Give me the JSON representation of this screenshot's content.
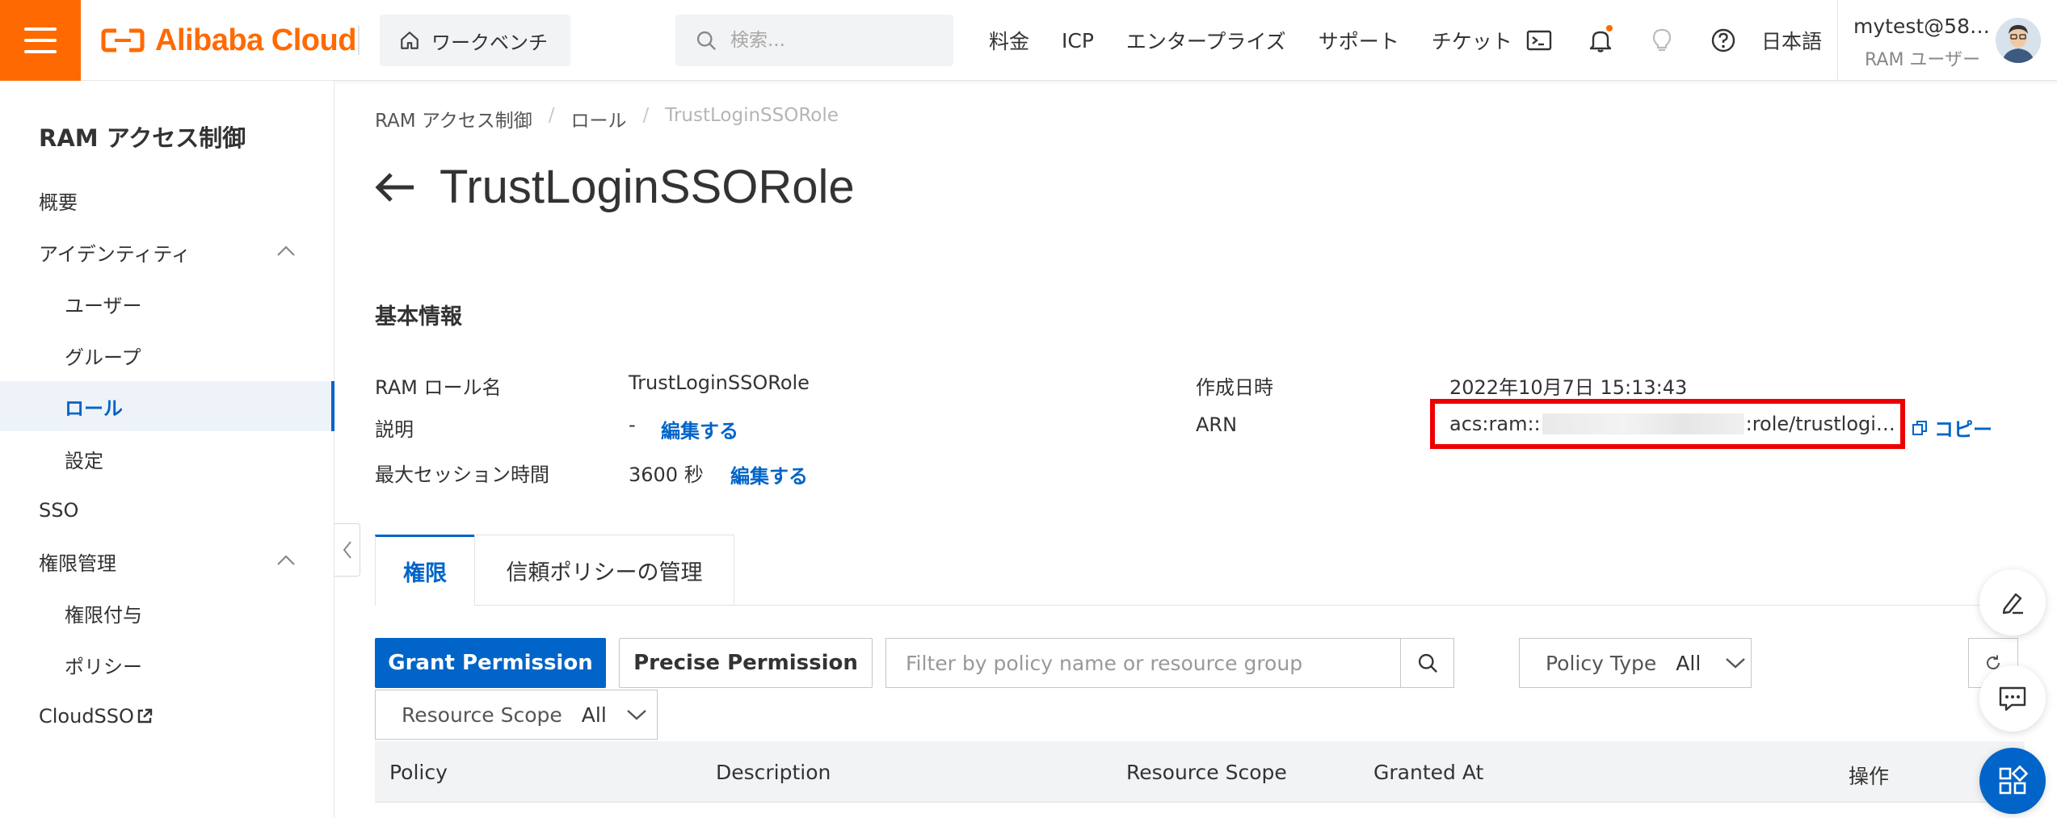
{
  "topbar": {
    "logo_text": "Alibaba Cloud",
    "workbench_label": "ワークベンチ",
    "search_placeholder": "検索...",
    "nav": [
      "料金",
      "ICP",
      "エンタープライズ",
      "サポート",
      "チケット"
    ],
    "language": "日本語",
    "user_name": "mytest@58…",
    "user_role": "RAM ユーザー",
    "has_notification_dot": true
  },
  "sidebar": {
    "title": "RAM アクセス制御",
    "items": [
      {
        "label": "概要",
        "level": 1
      },
      {
        "label": "アイデンティティ",
        "level": 1,
        "expanded": true
      },
      {
        "label": "ユーザー",
        "level": 2
      },
      {
        "label": "グループ",
        "level": 2
      },
      {
        "label": "ロール",
        "level": 2,
        "active": true
      },
      {
        "label": "設定",
        "level": 2
      },
      {
        "label": "SSO",
        "level": 1
      },
      {
        "label": "権限管理",
        "level": 1,
        "expanded": true
      },
      {
        "label": "権限付与",
        "level": 2
      },
      {
        "label": "ポリシー",
        "level": 2
      },
      {
        "label": "CloudSSO",
        "level": 1,
        "external": true
      }
    ]
  },
  "breadcrumb": [
    "RAM アクセス制御",
    "ロール",
    "TrustLoginSSORole"
  ],
  "page_title": "TrustLoginSSORole",
  "basic_info": {
    "section_title": "基本情報",
    "role_name_label": "RAM ロール名",
    "role_name_value": "TrustLoginSSORole",
    "description_label": "説明",
    "description_value": "-",
    "edit_label": "編集する",
    "max_session_label": "最大セッション時間",
    "max_session_value": "3600 秒",
    "created_label": "作成日時",
    "created_value": "2022年10月7日 15:13:43",
    "arn_label": "ARN",
    "arn_prefix": "acs:ram::",
    "arn_suffix": ":role/trustlogi…",
    "copy_label": "コピー"
  },
  "tabs": [
    {
      "label": "権限",
      "active": true
    },
    {
      "label": "信頼ポリシーの管理",
      "active": false
    }
  ],
  "toolbar": {
    "grant_label": "Grant Permission",
    "precise_label": "Precise Permission",
    "filter_placeholder": "Filter by policy name or resource group",
    "policy_type_label": "Policy Type",
    "policy_type_value": "All",
    "resource_scope_label": "Resource Scope",
    "resource_scope_value": "All"
  },
  "table": {
    "columns": [
      "Policy",
      "Description",
      "Resource Scope",
      "Granted At",
      "操作"
    ]
  },
  "colors": {
    "brand_orange": "#ff6a00",
    "primary_blue": "#0064c8",
    "highlight_red": "#ee0000"
  }
}
